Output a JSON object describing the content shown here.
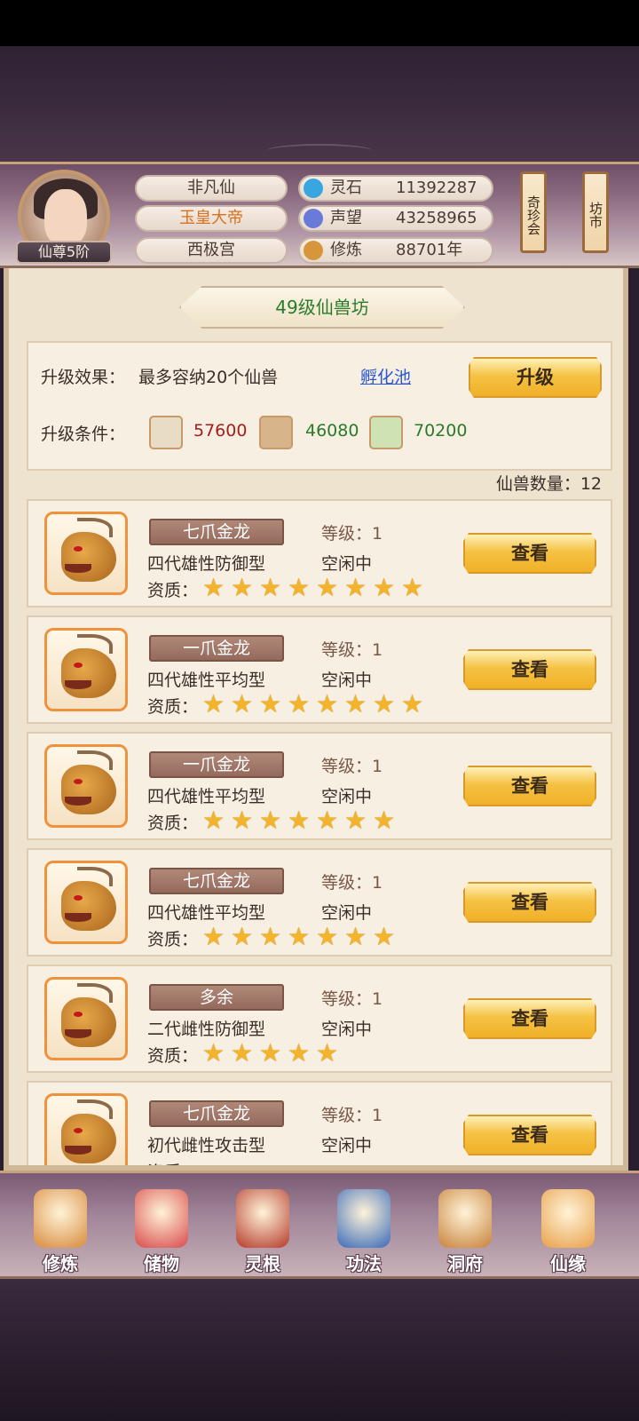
{
  "header": {
    "rank": "仙尊5阶",
    "titles": [
      "非凡仙",
      "玉皇大帝",
      "西极宫"
    ],
    "resources": [
      {
        "label": "灵石",
        "value": "11392287",
        "icon": "spirit-stone-icon",
        "color": "#3aa6e0"
      },
      {
        "label": "声望",
        "value": "43258965",
        "icon": "prestige-crystal-icon",
        "color": "#6a7ad8"
      },
      {
        "label": "修炼",
        "value": "88701年",
        "icon": "meditation-icon",
        "color": "#d8963c"
      }
    ],
    "side_buttons": [
      "奇珍会",
      "坊市"
    ]
  },
  "panel": {
    "title": "49级仙兽坊",
    "upgrade_effect_label": "升级效果：",
    "upgrade_effect_value": "最多容纳20个仙兽",
    "hatch_link": "孵化池",
    "upgrade_button": "升级",
    "upgrade_cond_label": "升级条件：",
    "materials": [
      {
        "icon": "ore-icon",
        "value": "57600",
        "color": "#a81c1c"
      },
      {
        "icon": "wood-icon",
        "value": "46080",
        "color": "#2a7a2a"
      },
      {
        "icon": "herb-icon",
        "value": "70200",
        "color": "#2a7a2a"
      }
    ],
    "beast_count": "仙兽数量：12"
  },
  "beasts": [
    {
      "name": "七爪金龙",
      "level": "等级：1",
      "type": "四代雄性防御型",
      "status": "空闲中",
      "quality_label": "资质：",
      "stars": 8,
      "button": "查看"
    },
    {
      "name": "一爪金龙",
      "level": "等级：1",
      "type": "四代雄性平均型",
      "status": "空闲中",
      "quality_label": "资质：",
      "stars": 8,
      "button": "查看"
    },
    {
      "name": "一爪金龙",
      "level": "等级：1",
      "type": "四代雄性平均型",
      "status": "空闲中",
      "quality_label": "资质：",
      "stars": 7,
      "button": "查看"
    },
    {
      "name": "七爪金龙",
      "level": "等级：1",
      "type": "四代雄性平均型",
      "status": "空闲中",
      "quality_label": "资质：",
      "stars": 7,
      "button": "查看"
    },
    {
      "name": "多余",
      "level": "等级：1",
      "type": "二代雌性防御型",
      "status": "空闲中",
      "quality_label": "资质：",
      "stars": 5,
      "button": "查看"
    },
    {
      "name": "七爪金龙",
      "level": "等级：1",
      "type": "初代雌性攻击型",
      "status": "空闲中",
      "quality_label": "资质：",
      "stars": 0,
      "button": "查看"
    }
  ],
  "nav": [
    {
      "label": "修炼",
      "icon": "cultivate-icon",
      "color": "#d88a3c"
    },
    {
      "label": "储物",
      "icon": "storage-bag-icon",
      "color": "#d84a4a"
    },
    {
      "label": "灵根",
      "icon": "spirit-root-icon",
      "color": "#b43a2a"
    },
    {
      "label": "功法",
      "icon": "scroll-book-icon",
      "color": "#3a6ab8"
    },
    {
      "label": "洞府",
      "icon": "cave-palace-icon",
      "color": "#c8823a"
    },
    {
      "label": "仙缘",
      "icon": "gourd-icon",
      "color": "#e8a04a"
    }
  ]
}
